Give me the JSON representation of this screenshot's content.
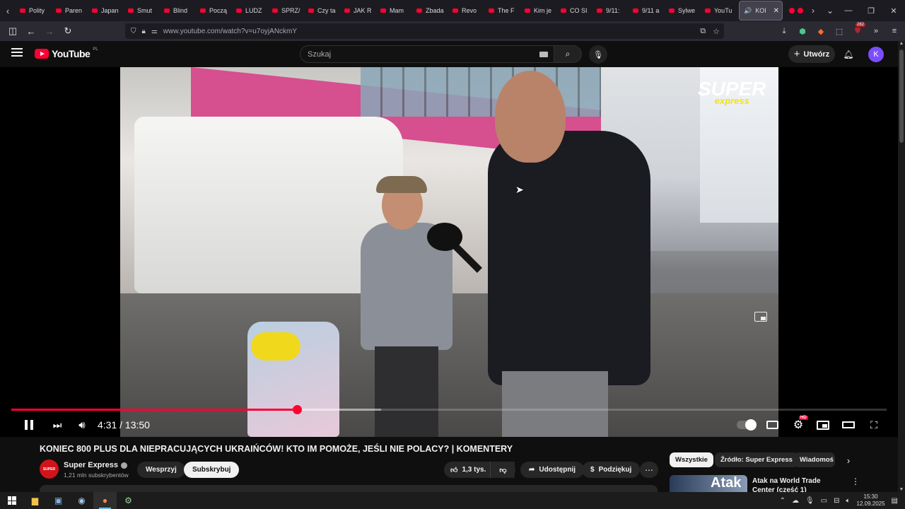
{
  "browser": {
    "tabs": [
      {
        "label": "Polity"
      },
      {
        "label": "Paren"
      },
      {
        "label": "Japan"
      },
      {
        "label": "Smut"
      },
      {
        "label": "Blind"
      },
      {
        "label": "Począ"
      },
      {
        "label": "LUDZ"
      },
      {
        "label": "SPRZ/"
      },
      {
        "label": "Czy ta"
      },
      {
        "label": "JAK R"
      },
      {
        "label": "Mam"
      },
      {
        "label": "Zbada"
      },
      {
        "label": "Revo"
      },
      {
        "label": "The F"
      },
      {
        "label": "Kim je"
      },
      {
        "label": "CO SI"
      },
      {
        "label": "9/11:"
      },
      {
        "label": "9/11 a"
      },
      {
        "label": "Sylwe"
      },
      {
        "label": "YouTu"
      }
    ],
    "active_tab": {
      "label": "KOI",
      "close": "✕"
    },
    "url": "www.youtube.com/watch?v=u7oyjANckmY",
    "extension_badge": "282"
  },
  "youtube": {
    "logo_text": "YouTube",
    "country_code": "PL",
    "search_placeholder": "Szukaj",
    "create_label": "Utwórz",
    "avatar_letter": "K"
  },
  "player": {
    "current_time": "4:31",
    "separator": " / ",
    "duration": "13:50",
    "progress_played_fraction": 0.3265,
    "progress_loaded_fraction": 0.4225,
    "watermark_top": "SUPER",
    "watermark_bottom": "express",
    "hd_badge": "HD"
  },
  "video_info": {
    "title": "KONIEC 800 PLUS DLA NIEPRACUJĄCYCH UKRAIŃCÓW! KTO IM POMOŻE, JEŚLI NIE POLACY? | KOMENTERY",
    "channel_name": "Super Express",
    "channel_avatar_text": "SUPER",
    "subscribers": "1,21 mln subskrybentów",
    "support_label": "Wesprzyj",
    "subscribe_label": "Subskrybuj",
    "likes": "1,3 tys.",
    "share_label": "Udostępnij",
    "thanks_label": "Podziękuj"
  },
  "sidebar": {
    "chips": [
      {
        "label": "Wszystkie",
        "active": true
      },
      {
        "label": "Źródło: Super Express",
        "active": false
      },
      {
        "label": "Wiadomoś",
        "active": false
      }
    ],
    "recommendation": {
      "thumb_text": "Atak",
      "title": "Atak na World Trade Center (część 1)"
    }
  },
  "taskbar": {
    "time": "15:30",
    "date": "12.09.2025"
  }
}
